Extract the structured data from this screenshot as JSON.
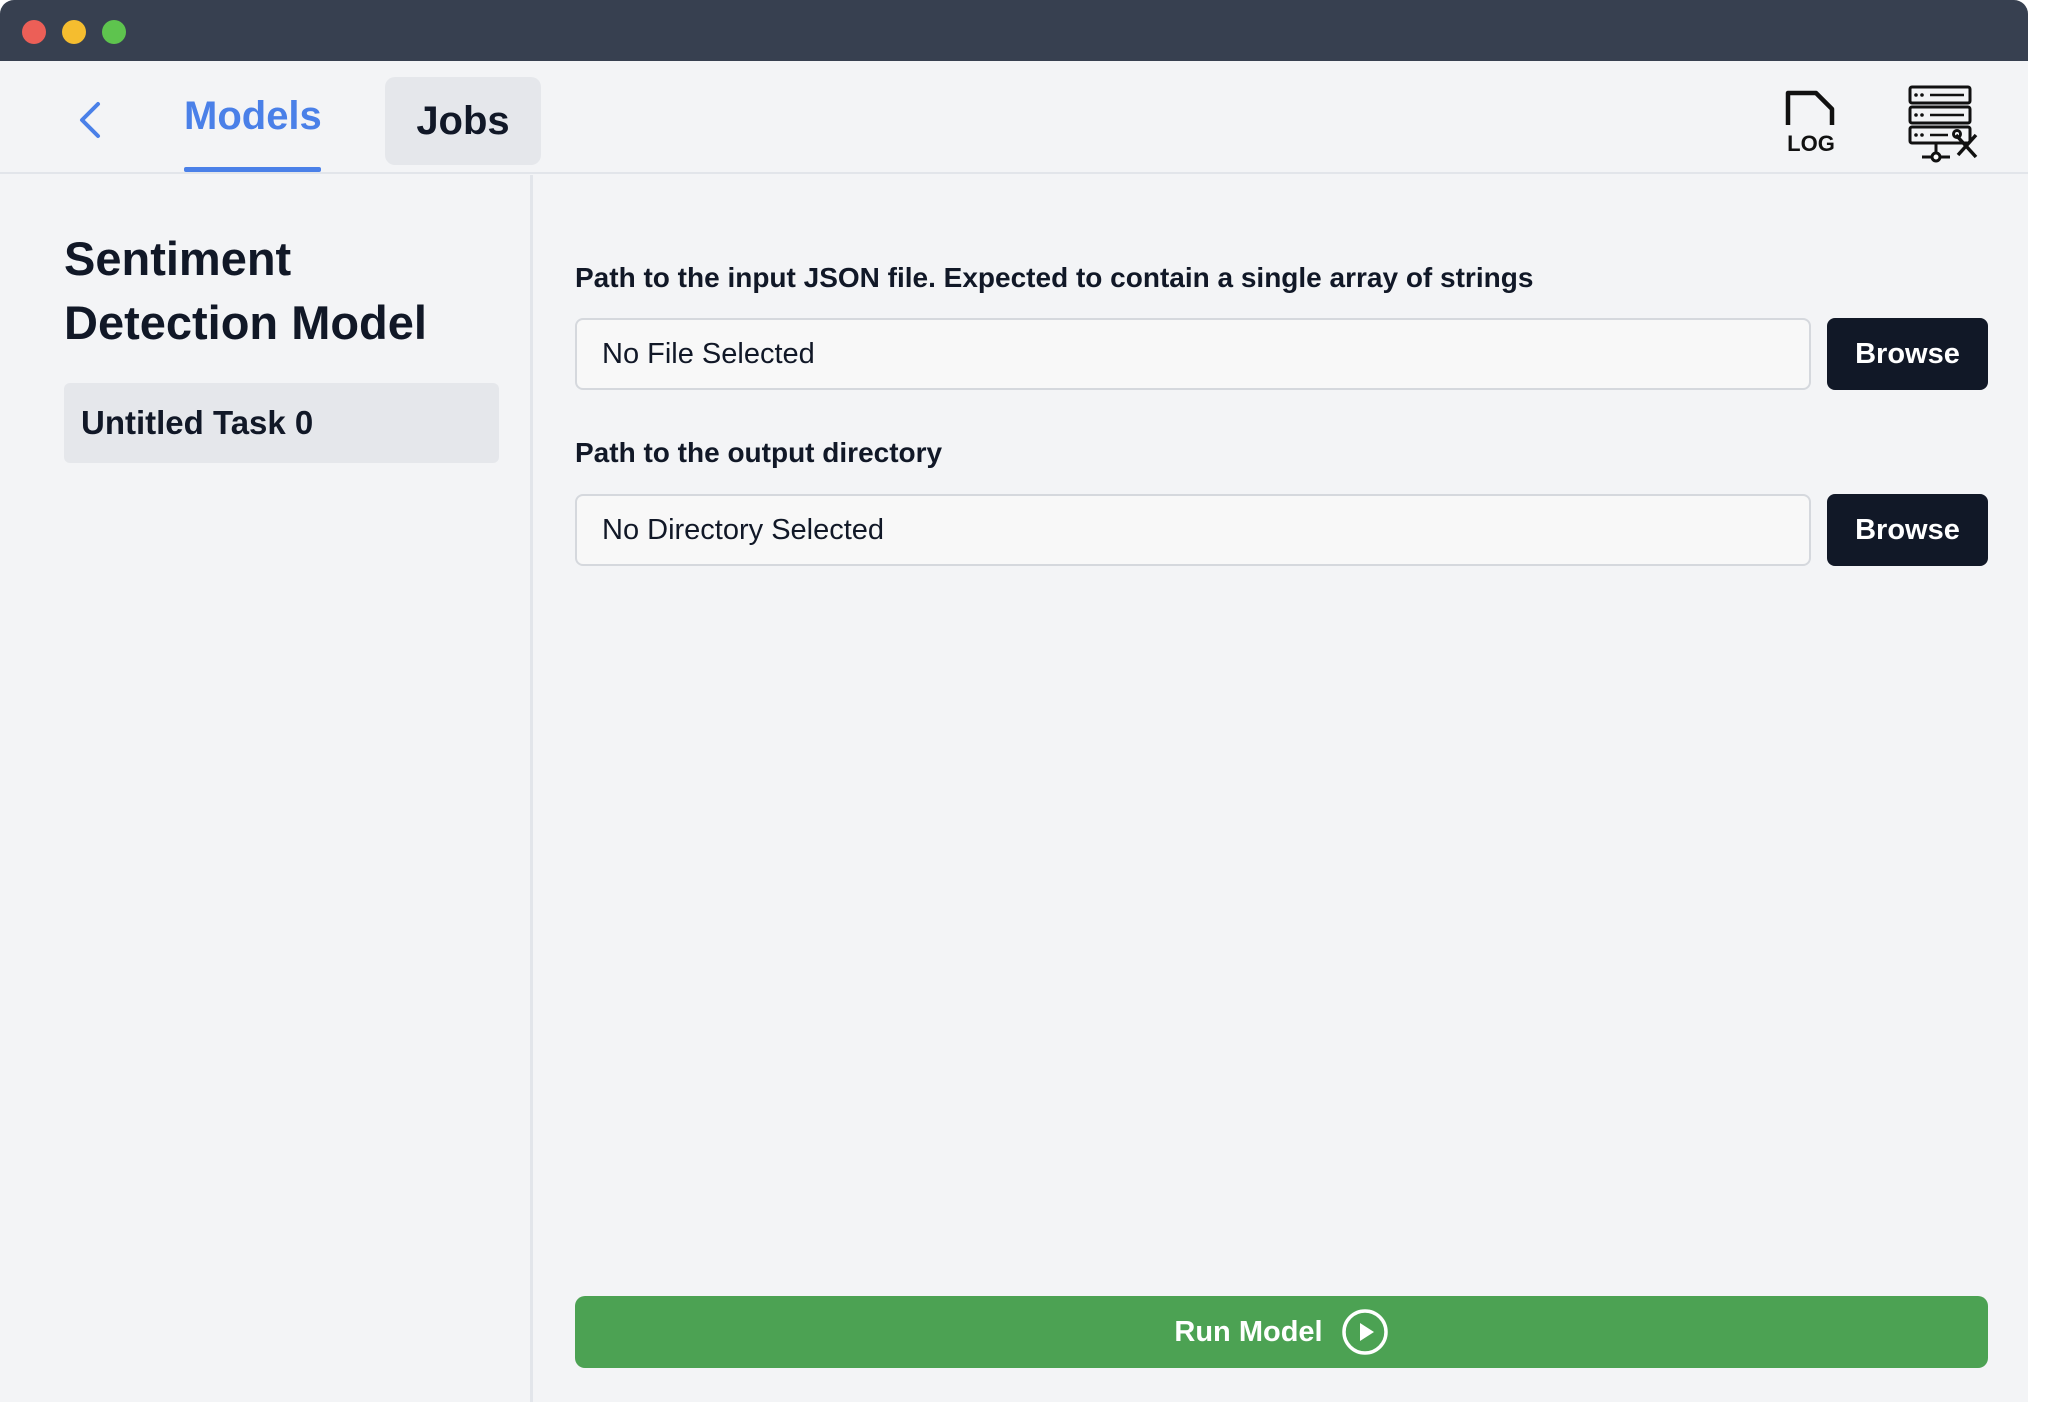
{
  "nav": {
    "tabs": {
      "models": "Models",
      "jobs": "Jobs"
    },
    "log_icon_text": "LOG"
  },
  "sidebar": {
    "model_title": "Sentiment Detection Model",
    "tasks": [
      "Untitled Task 0"
    ]
  },
  "form": {
    "input_file": {
      "label": "Path to the input JSON file. Expected to contain a single array of strings",
      "value": "No File Selected",
      "button": "Browse"
    },
    "output_dir": {
      "label": "Path to the output directory",
      "value": "No Directory Selected",
      "button": "Browse"
    },
    "run_button": "Run Model"
  },
  "colors": {
    "titlebar": "#374050",
    "accent": "#4a80e8",
    "dark_button": "#111827",
    "run_button": "#4ca253"
  }
}
